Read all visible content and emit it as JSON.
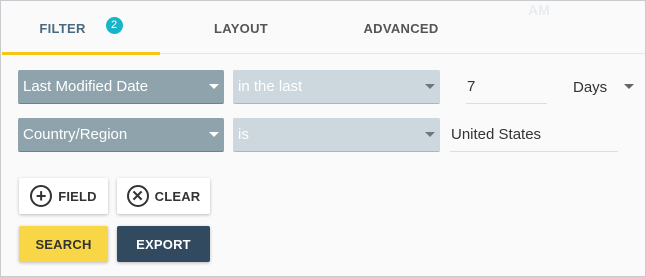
{
  "tabs": {
    "filter_label": "FILTER",
    "filter_badge": "2",
    "layout_label": "LAYOUT",
    "advanced_label": "ADVANCED",
    "ghost_text": "AM"
  },
  "rows": [
    {
      "field": "Last Modified Date",
      "operator": "in the last",
      "value": "7",
      "unit": "Days"
    },
    {
      "field": "Country/Region",
      "operator": "is",
      "value": "United States"
    }
  ],
  "buttons": {
    "field_label": "FIELD",
    "clear_label": "CLEAR",
    "search_label": "SEARCH",
    "export_label": "EXPORT"
  },
  "colors": {
    "accent_underline": "#f5c518",
    "badge": "#18b5c8",
    "search_button": "#f9d646",
    "export_button": "#314a60"
  }
}
